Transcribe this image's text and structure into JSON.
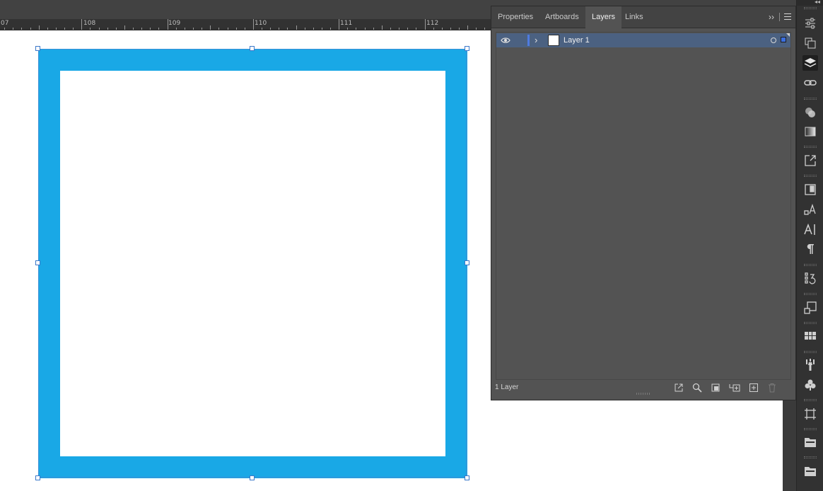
{
  "ruler": {
    "labels": [
      "07",
      "108",
      "109",
      "110",
      "111",
      "112"
    ]
  },
  "layers_panel": {
    "tabs": [
      {
        "label": "Properties",
        "active": false
      },
      {
        "label": "Artboards",
        "active": false
      },
      {
        "label": "Layers",
        "active": true
      },
      {
        "label": "Links",
        "active": false
      }
    ],
    "overflow_label": "››",
    "layers": [
      {
        "name": "Layer 1",
        "visible": true,
        "expanded": false,
        "color": "#4f7be0"
      }
    ],
    "footer": {
      "count_label": "1 Layer",
      "buttons": [
        "export-icon",
        "locate-object-icon",
        "make-clipping-mask-icon",
        "new-sublayer-icon",
        "new-layer-icon",
        "trash-icon"
      ]
    }
  },
  "artwork": {
    "stroke_color": "#19a8e6",
    "fill_color": "#ffffff",
    "selection_color": "#3b78c9"
  },
  "toolstrip": {
    "collapse_label": "◂◂",
    "active_panel": "layers-panel-icon",
    "icons": [
      "properties-panel-icon",
      "artboards-panel-icon",
      "layers-panel-icon",
      "links-panel-icon",
      "transparency-panel-icon",
      "gradient-panel-icon",
      "export-panel-icon",
      "libraries-panel-icon",
      "character-styles-icon",
      "character-panel-icon",
      "paragraph-panel-icon",
      "actions-panel-icon",
      "transform-panel-icon",
      "swatches-grid-icon",
      "brushes-panel-icon",
      "symbols-panel-icon",
      "artboard-tool-icon",
      "folder-icon",
      "folder-icon-2"
    ]
  }
}
